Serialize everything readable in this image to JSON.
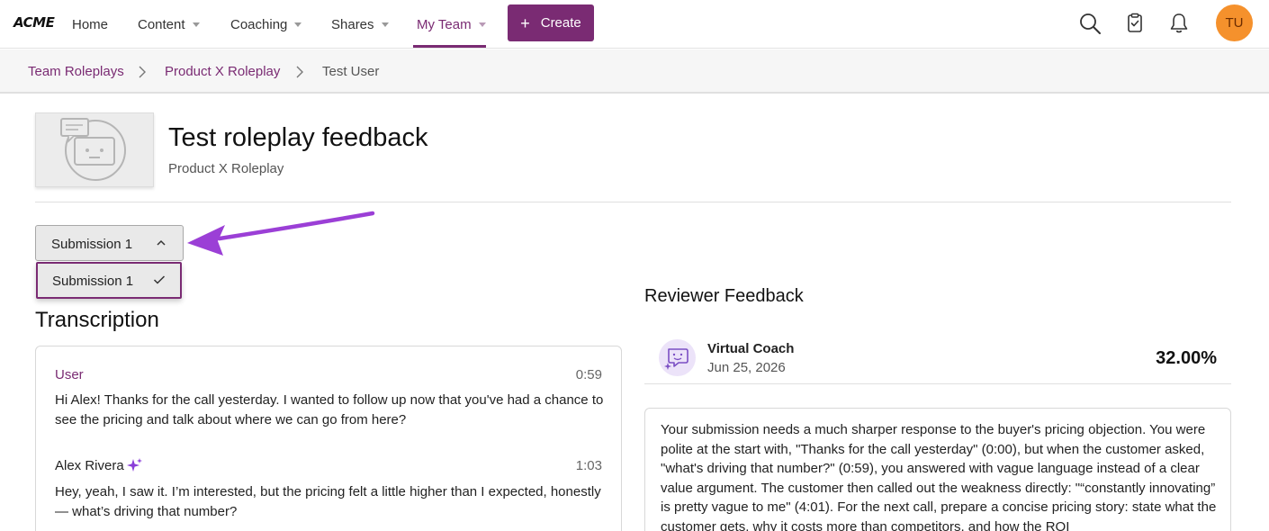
{
  "nav": {
    "logo": "ACME",
    "items": [
      {
        "label": "Home"
      },
      {
        "label": "Content"
      },
      {
        "label": "Coaching"
      },
      {
        "label": "Shares"
      },
      {
        "label": "My Team"
      }
    ],
    "active_item": "My Team",
    "create_label": "Create",
    "create_icon": "plus-icon",
    "icons": [
      "search-icon",
      "clipboard-check-icon",
      "bell-icon"
    ],
    "avatar_initials": "TU",
    "colors": {
      "brand": "#7a2b73",
      "avatar": "#f5912c"
    }
  },
  "breadcrumb": {
    "items": [
      "Team Roleplays",
      "Product X Roleplay",
      "Test User"
    ]
  },
  "header": {
    "title": "Test roleplay feedback",
    "subtitle": "Product X Roleplay",
    "thumbnail_icon": "robot-chat-icon"
  },
  "submission": {
    "selected": "Submission 1",
    "options": [
      "Submission 1"
    ],
    "annotation_arrow_color": "#9b3fd6"
  },
  "transcription": {
    "title": "Transcription",
    "entries": [
      {
        "speaker": "User",
        "time": "0:59",
        "text": "Hi Alex! Thanks for the call yesterday. I wanted to follow up now that you've had a chance to see the pricing and talk about where we can go from here?"
      },
      {
        "speaker": "Alex Rivera",
        "time": "1:03",
        "ai_icon": "sparkle-icon",
        "text": "Hey, yeah, I saw it. I’m interested, but the pricing felt a little higher than I expected, honestly — what’s driving that number?"
      }
    ]
  },
  "feedback": {
    "title": "Reviewer Feedback",
    "reviewer": "Virtual Coach",
    "date": "Jun 25, 2026",
    "score": "32.00%",
    "text": "Your submission needs a much sharper response to the buyer's pricing objection. You were polite at the start with, \"Thanks for the call yesterday\" (0:00), but when the customer asked, \"what's driving that number?\" (0:59), you answered with vague language instead of a clear value argument. The customer then called out the weakness directly: \"“constantly innovating” is pretty vague to me\" (4:01). For the next call, prepare a concise pricing story: state what the customer gets, why it costs more than competitors, and how the ROI"
  }
}
